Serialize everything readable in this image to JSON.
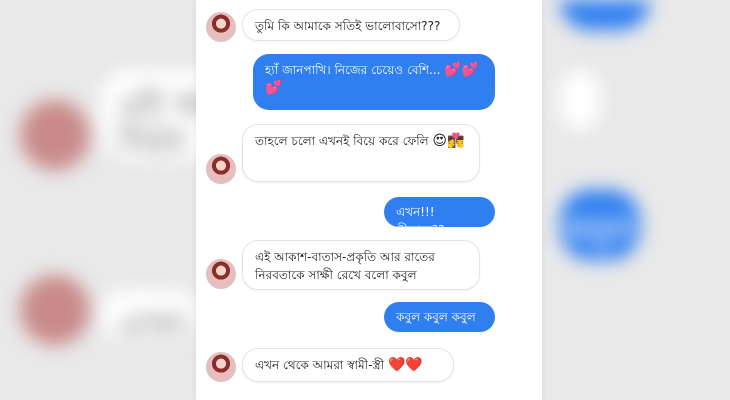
{
  "conversation": {
    "messages": [
      {
        "side": "incoming",
        "text": "তুমি কি আমাকে সতিই ভালোবাসো???"
      },
      {
        "side": "outgoing",
        "text": "হ্যাঁ জানপাখি। নিজের চেয়েও বেশি...",
        "emoji": "💕💕💕"
      },
      {
        "side": "incoming",
        "text": "তাহলে চলো এখনই বিয়ে করে ফেলি",
        "emoji": "😍👩‍❤️‍💋‍👨"
      },
      {
        "side": "outgoing",
        "text": "এখন!!! কীভাবে??"
      },
      {
        "side": "incoming",
        "text": "এই আকাশ-বাতাস-প্রকৃতি আর রাতের নিরবতাকে সাক্ষী রেখে বলো কবুল"
      },
      {
        "side": "outgoing",
        "text": "কবুল কবুল কবুল"
      },
      {
        "side": "incoming",
        "text": "এখন থেকে আমরা স্বামী-স্ত্রী",
        "emoji": "❤️❤️"
      }
    ]
  },
  "background": {
    "blurred_text_1": "এই আ",
    "blurred_text_2": "নিরব",
    "blurred_text_3": "কবুল",
    "blurred_text_4": "এখন"
  },
  "colors": {
    "outgoing_bubble": "#2f7ff0",
    "incoming_bubble": "#ffffff"
  }
}
